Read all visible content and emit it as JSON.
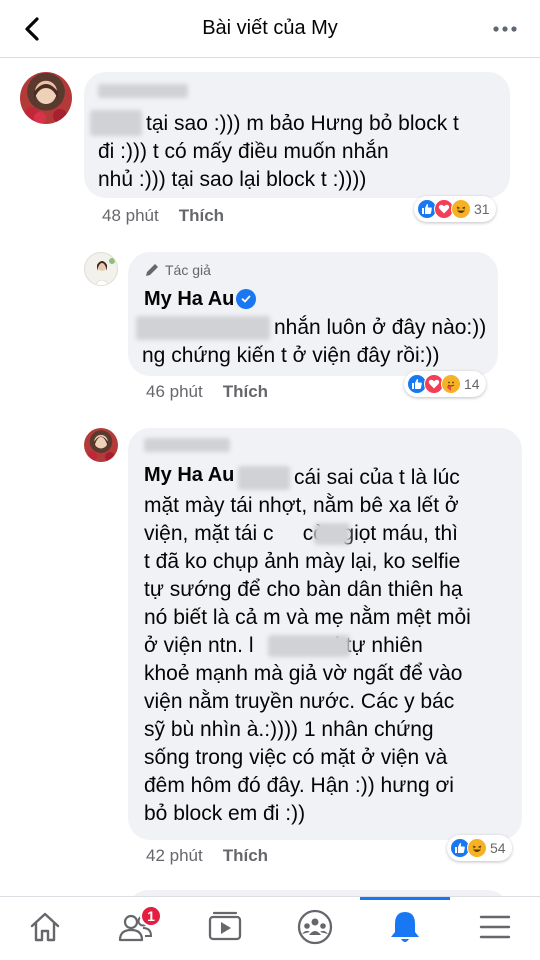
{
  "header": {
    "title": "Bài viết của My"
  },
  "comments": [
    {
      "text_lines": [
        "tại sao :))) m bảo Hưng bỏ block t",
        "đi :))) t có mấy điều muốn nhắn",
        "nhủ :))) tại sao lại block t :))))"
      ],
      "time": "48 phút",
      "like_label": "Thích",
      "reaction_count": "31",
      "reactions": [
        "like",
        "love",
        "haha"
      ]
    },
    {
      "author_tag": "Tác giả",
      "author_name": "My Ha Au",
      "text_lines": [
        "nhắn luôn ở đây nào:))",
        "ng chứng kiến t ở viện đây rồi:))"
      ],
      "time": "46 phút",
      "like_label": "Thích",
      "reaction_count": "14",
      "reactions": [
        "like",
        "love",
        "care"
      ]
    },
    {
      "author_name_partial": "Nabi Kim",
      "mention": "My Ha Au",
      "text_lines": [
        "cái sai của t là lúc",
        "mặt mày tái nhợt, nằm bê xa lết ở",
        "viện, mặt tái c     còn giọt máu, thì",
        "t đã ko chụp ảnh mày lại, ko selfie",
        "tự sướng để cho bàn dân thiên hạ",
        "nó biết là cả m và mẹ nằm mệt mỏi",
        "ở viện ntn. l            ai tự nhiên",
        "khoẻ mạnh mà giả vờ ngất để vào",
        "viện nằm truyền nước. Các y bác",
        "sỹ bù nhìn à.:)))) 1 nhân chứng",
        "sống trong việc có mặt ở viện và",
        "đêm hôm đó đây. Hận :)) hưng ơi",
        "bỏ block em đi :))"
      ],
      "time": "42 phút",
      "like_label": "Thích",
      "reaction_count": "54",
      "reactions": [
        "like",
        "haha"
      ]
    }
  ],
  "bottom_nav": {
    "items": [
      {
        "name": "home-icon"
      },
      {
        "name": "friends-icon",
        "badge": "1"
      },
      {
        "name": "watch-icon"
      },
      {
        "name": "groups-icon"
      },
      {
        "name": "notifications-icon",
        "active": true
      },
      {
        "name": "menu-icon"
      }
    ]
  },
  "colors": {
    "accent": "#1877f2",
    "bubble": "#f0f2f5",
    "meta_text": "#65676b",
    "badge": "#e41e3f"
  }
}
